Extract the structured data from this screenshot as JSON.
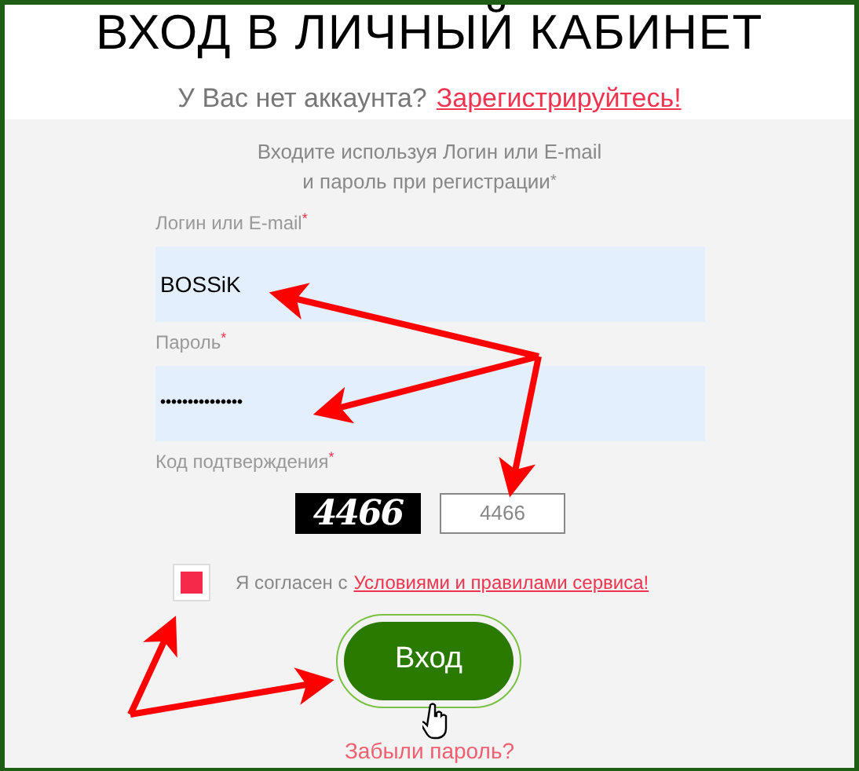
{
  "title": "ВХОД В ЛИЧНЫЙ КАБИНЕТ",
  "signup": {
    "text": "У Вас нет аккаунта?",
    "link": "Зарегистрируйтесь!"
  },
  "intro": [
    "Входите используя Логин или E-mail",
    "и пароль при регистрации"
  ],
  "intro_mark": "*",
  "fields": [
    {
      "label": "Логин или E-mail",
      "required": "*",
      "value": "BOSSiK",
      "kind": "text"
    },
    {
      "label": "Пароль",
      "required": "*",
      "value": "•••••••••••••••",
      "kind": "password"
    }
  ],
  "captcha": {
    "label": "Код подтверждения",
    "required": "*",
    "image_text": "4466",
    "value": "4466"
  },
  "agree": {
    "checked": true,
    "text": "Я согласен с",
    "link": "Условиями и правилами сервиса!"
  },
  "login_button": "Вход",
  "forgot": "Забыли пароль?"
}
